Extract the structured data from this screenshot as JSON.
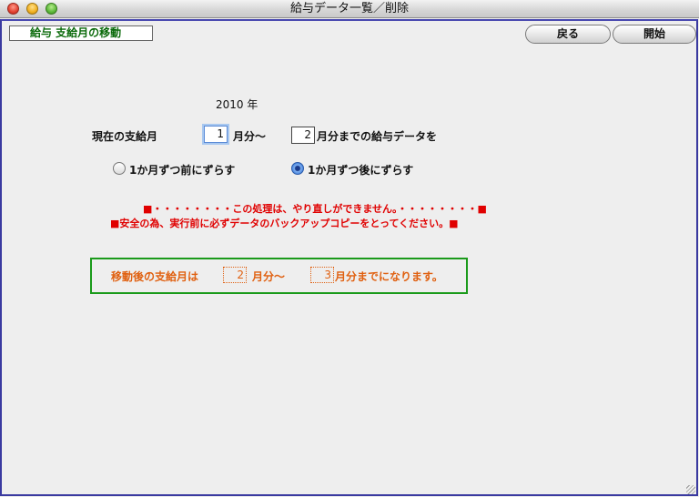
{
  "window": {
    "title": "給与データ一覧／削除"
  },
  "header": {
    "label": "給与 支給月の移動"
  },
  "buttons": {
    "back": "戻る",
    "start": "開始"
  },
  "form": {
    "year": "2010 年",
    "current_label": "現在の支給月",
    "from_month": "1",
    "from_suffix": "月分～",
    "to_month": "2",
    "to_suffix": "月分までの給与データを",
    "radio_prev": "1か月ずつ前にずらす",
    "radio_next": "1か月ずつ後にずらす",
    "selected": "next"
  },
  "warnings": {
    "line1": "■・・・・・・・・この処理は、やり直しができません。・・・・・・・・■",
    "line2": "■安全の為、実行前に必ずデータのバックアップコピーをとってください。■"
  },
  "result": {
    "label": "移動後の支給月は",
    "from_month": "2",
    "from_suffix": "月分～",
    "to_month": "3",
    "to_suffix": "月分までになります。"
  }
}
